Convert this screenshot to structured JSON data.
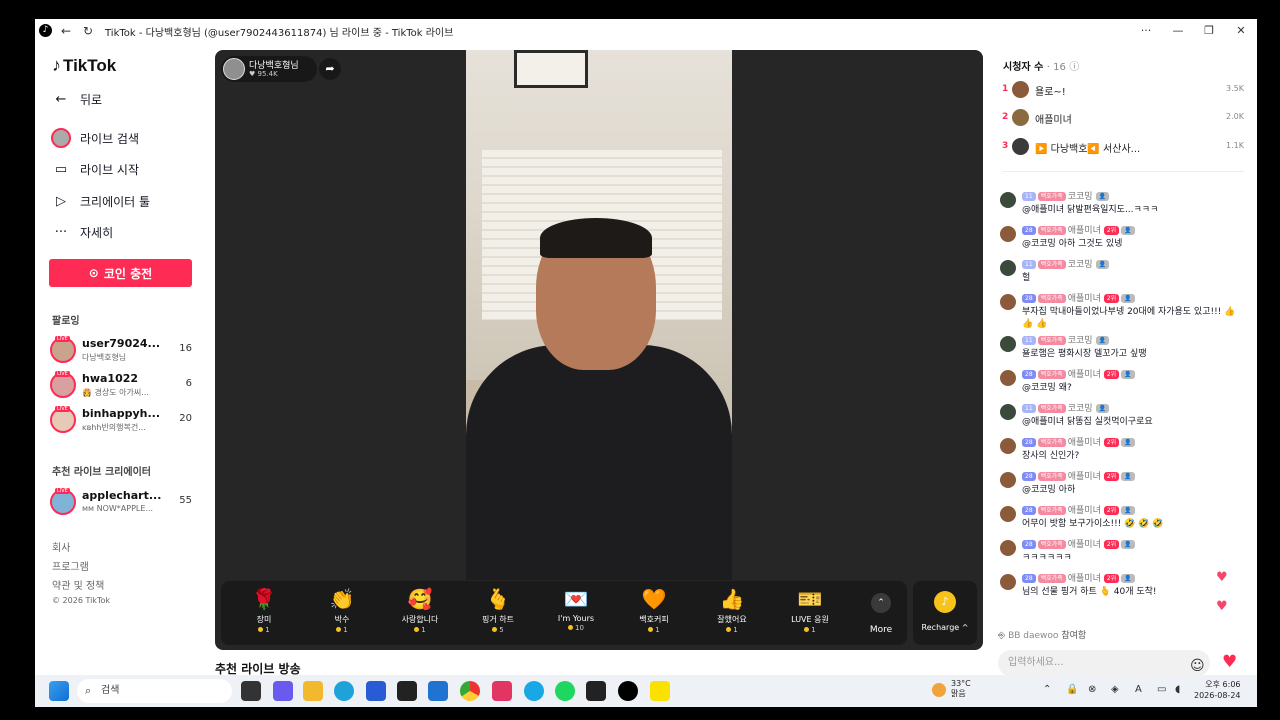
{
  "window": {
    "title": "TikTok - 다낭백호형님 (@user7902443611874) 님 라이브 중 - TikTok 라이브",
    "ctl_menu": "···",
    "ctl_min": "—",
    "ctl_max": "❐",
    "ctl_close": "✕"
  },
  "sidebar": {
    "logo": "TikTok",
    "nav": [
      {
        "label": "뒤로",
        "icon": "back-arrow-icon"
      },
      {
        "label": "라이브 검색",
        "icon": "avatar-icon"
      },
      {
        "label": "라이브 시작",
        "icon": "camera-icon"
      },
      {
        "label": "크리에이터 툴",
        "icon": "play-icon"
      },
      {
        "label": "자세히",
        "icon": "more-icon"
      }
    ],
    "coin_button": "코인 충전",
    "following_title": "팔로잉",
    "following": [
      {
        "name": "user79024...",
        "sub": "다낭백호형님",
        "count": "16"
      },
      {
        "name": "hwa1022",
        "sub": "👸 경상도 아가씨...",
        "count": "6"
      },
      {
        "name": "binhappyh...",
        "sub": "ᴋʙhh빈의행복건...",
        "count": "20"
      }
    ],
    "recommended_title": "추천 라이브 크리에이터",
    "recommended": [
      {
        "name": "applechart...",
        "sub": "ᴍᴍ NOW*APPLE...",
        "count": "55"
      }
    ],
    "live_badge": "LIVE",
    "footer": [
      "회사",
      "프로그램",
      "약관 및 정책",
      "© 2026 TikTok"
    ]
  },
  "player": {
    "host_name": "다낭백호형님",
    "host_likes": "♥ 95.4K",
    "gifts": [
      {
        "icon": "🌹",
        "label": "장미",
        "price": "1"
      },
      {
        "icon": "👏",
        "label": "박수",
        "price": "1"
      },
      {
        "icon": "🥰",
        "label": "사랑합니다",
        "price": "1"
      },
      {
        "icon": "🫰",
        "label": "핑거 하트",
        "price": "5"
      },
      {
        "icon": "💌",
        "label": "I'm Yours",
        "price": "10"
      },
      {
        "icon": "🧡",
        "label": "백호커피",
        "price": "1"
      },
      {
        "icon": "👍",
        "label": "잘했어요",
        "price": "1"
      },
      {
        "icon": "🎫",
        "label": "LUVE 응원",
        "price": "1"
      }
    ],
    "more_label": "More",
    "recharge_label": "Recharge ^",
    "below_title": "추천 라이브 방송"
  },
  "viewers": {
    "title": "시청자 수",
    "count": "· 16",
    "ranks": [
      {
        "rank": "1",
        "name": "욜로~!",
        "value": "3.5K"
      },
      {
        "rank": "2",
        "name": "애플미녀",
        "value": "2.0K"
      },
      {
        "rank": "3",
        "name": "▶️ 다낭백호◀️ 서산사...",
        "value": "1.1K"
      }
    ]
  },
  "chat": [
    {
      "lv": "11",
      "fan": "백호가족",
      "name": "코코밍",
      "rank": "",
      "text": "@애플미녀 닭발편육일지도...ㅋㅋㅋ"
    },
    {
      "lv": "28",
      "fan": "백호가족",
      "name": "애플미녀",
      "rank": "2위",
      "text": "@코코밍 아하 그것도 있넹"
    },
    {
      "lv": "11",
      "fan": "백호가족",
      "name": "코코밍",
      "rank": "",
      "text": "헐"
    },
    {
      "lv": "28",
      "fan": "백호가족",
      "name": "애플미녀",
      "rank": "2위",
      "text": "부자집 막내아들이었나부넹 20대에 자가용도 있고!!! 👍 👍 👍"
    },
    {
      "lv": "11",
      "fan": "백호가족",
      "name": "코코밍",
      "rank": "",
      "text": "욜로햄은 평화시장 델꼬가고 싶땡"
    },
    {
      "lv": "28",
      "fan": "백호가족",
      "name": "애플미녀",
      "rank": "2위",
      "text": "@코코밍 왜?"
    },
    {
      "lv": "11",
      "fan": "백호가족",
      "name": "코코밍",
      "rank": "",
      "text": "@애플미녀 닭똥집 실컷먹이구로요"
    },
    {
      "lv": "28",
      "fan": "백호가족",
      "name": "애플미녀",
      "rank": "2위",
      "text": "장사의 신인가?"
    },
    {
      "lv": "28",
      "fan": "백호가족",
      "name": "애플미녀",
      "rank": "2위",
      "text": "@코코밍 아하"
    },
    {
      "lv": "28",
      "fan": "백호가족",
      "name": "애플미녀",
      "rank": "2위",
      "text": "어무이 밧함 보구가이소!!! 🤣 🤣 🤣"
    },
    {
      "lv": "28",
      "fan": "백호가족",
      "name": "애플미녀",
      "rank": "2위",
      "text": "ㅋㅋㅋㅋㅋㅋ"
    },
    {
      "lv": "28",
      "fan": "백호가족",
      "name": "애플미녀",
      "rank": "2위",
      "text": "님의 선물 핑거 하트 🫰 40개 도착!"
    }
  ],
  "join": {
    "name": "BB daewoo",
    "text": "참여함"
  },
  "chat_input": {
    "placeholder": "입력하세요..."
  },
  "taskbar": {
    "search": "검색",
    "temp": "33°C",
    "weather": "맑음",
    "time": "오후 6:06",
    "date": "2026-08-24"
  }
}
